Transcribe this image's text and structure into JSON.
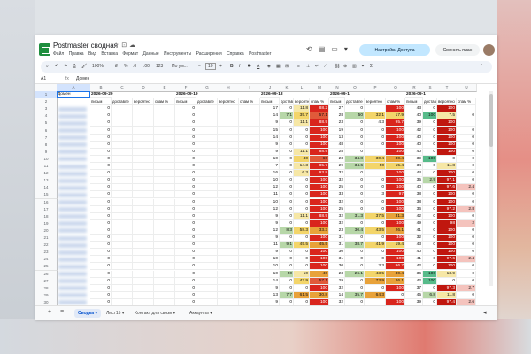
{
  "app": {
    "title": "Postmaster сводная",
    "menu": [
      "Файл",
      "Правка",
      "Вид",
      "Вставка",
      "Формат",
      "Данные",
      "Инструменты",
      "Расширения",
      "Справка",
      "Postmaster"
    ],
    "access_button": "Настройки Доступа",
    "plan_button": "Сменить план"
  },
  "toolbar": {
    "zoom": "100%",
    "currency": "₽",
    "percent": "%",
    "decimal_dec": ".0",
    "decimal_inc": ".00",
    "format_123": "123",
    "font": "По ум...",
    "font_size": "10",
    "bold": "B",
    "italic": "I",
    "strike": "S",
    "textcolor": "A"
  },
  "formula_bar": {
    "cell_ref": "A1",
    "fx": "fx",
    "content": "Домен"
  },
  "columns": [
    "A",
    "B",
    "C",
    "D",
    "E",
    "F",
    "G",
    "H",
    "I",
    "J",
    "K",
    "L",
    "M",
    "N",
    "O",
    "P",
    "Q",
    "R",
    "S",
    "T",
    "U"
  ],
  "header_row1": {
    "A": "Домен",
    "B": "2026-09-20",
    "F": "2026-09-19",
    "J": "2026-09-18",
    "N": "2026-09-1",
    "R": "2026-09-1"
  },
  "header_row2": [
    "письм",
    "доставле",
    "вероятно",
    "спам %",
    "письм",
    "доставле",
    "вероятно",
    "спам %",
    "письм",
    "доставле",
    "вероятно",
    "спам %",
    "письм",
    "доставле",
    "вероятно",
    "спам %",
    "письм",
    "доставле",
    "вероятно",
    "спам %"
  ],
  "rows": [
    {
      "r": 3,
      "c": [
        "0",
        "",
        "",
        "",
        "0",
        "",
        "",
        "",
        "17",
        "0",
        "11.8",
        "88.2",
        "27",
        "0",
        "",
        "100",
        "43",
        "0",
        "100",
        ""
      ]
    },
    {
      "r": 4,
      "c": [
        "0",
        "",
        "",
        "",
        "0",
        "",
        "",
        "",
        "14",
        "7.1",
        "35.7",
        "57.1",
        "28",
        "50",
        "32.1",
        "17.9",
        "40",
        "100",
        "7.5",
        "0"
      ]
    },
    {
      "r": 5,
      "c": [
        "0",
        "",
        "",
        "",
        "0",
        "",
        "",
        "",
        "9",
        "0",
        "11.1",
        "88.9",
        "23",
        "0",
        "4.3",
        "95.7",
        "39",
        "0",
        "100",
        ""
      ]
    },
    {
      "r": 6,
      "c": [
        "0",
        "",
        "",
        "",
        "0",
        "",
        "",
        "",
        "15",
        "0",
        "0",
        "100",
        "19",
        "0",
        "0",
        "100",
        "42",
        "0",
        "100",
        "0"
      ]
    },
    {
      "r": 7,
      "c": [
        "0",
        "",
        "",
        "",
        "0",
        "",
        "",
        "",
        "14",
        "0",
        "0",
        "100",
        "13",
        "0",
        "0",
        "100",
        "40",
        "0",
        "100",
        "0"
      ]
    },
    {
      "r": 8,
      "c": [
        "0",
        "",
        "",
        "",
        "0",
        "",
        "",
        "",
        "9",
        "0",
        "0",
        "100",
        "48",
        "0",
        "0",
        "100",
        "40",
        "0",
        "100",
        "0"
      ]
    },
    {
      "r": 9,
      "c": [
        "0",
        "",
        "",
        "",
        "0",
        "",
        "",
        "",
        "9",
        "0",
        "11.1",
        "88.9",
        "28",
        "0",
        "",
        "100",
        "40",
        "0",
        "100",
        "0"
      ]
    },
    {
      "r": 10,
      "c": [
        "0",
        "",
        "",
        "",
        "0",
        "",
        "",
        "",
        "10",
        "0",
        "40",
        "60",
        "23",
        "34.8",
        "30.4",
        "30.4",
        "39",
        "100",
        "0",
        "0"
      ]
    },
    {
      "r": 11,
      "c": [
        "0",
        "",
        "",
        "",
        "0",
        "",
        "",
        "",
        "7",
        "0",
        "14.3",
        "85.7",
        "29",
        "34.6",
        "50",
        "15.4",
        "34",
        "0",
        "11.8",
        "0"
      ]
    },
    {
      "r": 12,
      "c": [
        "0",
        "",
        "",
        "",
        "0",
        "",
        "",
        "",
        "16",
        "0",
        "6.3",
        "93.8",
        "32",
        "0",
        "",
        "100",
        "44",
        "0",
        "100",
        "0"
      ]
    },
    {
      "r": 13,
      "c": [
        "0",
        "",
        "",
        "",
        "0",
        "",
        "",
        "",
        "10",
        "0",
        "0",
        "100",
        "32",
        "0",
        "0",
        "100",
        "35",
        "2.9",
        "97.1",
        "0"
      ]
    },
    {
      "r": 14,
      "c": [
        "0",
        "",
        "",
        "",
        "0",
        "",
        "",
        "",
        "12",
        "0",
        "0",
        "100",
        "25",
        "0",
        "0",
        "100",
        "40",
        "0",
        "97.6",
        "2.4"
      ]
    },
    {
      "r": 15,
      "c": [
        "0",
        "",
        "",
        "",
        "0",
        "",
        "",
        "",
        "11",
        "0",
        "0",
        "100",
        "33",
        "0",
        "3",
        "97",
        "38",
        "0",
        "100",
        "0"
      ]
    },
    {
      "r": 16,
      "c": [
        "0",
        "",
        "",
        "",
        "0",
        "",
        "",
        "",
        "10",
        "0",
        "0",
        "100",
        "32",
        "0",
        "0",
        "100",
        "38",
        "0",
        "100",
        "0"
      ]
    },
    {
      "r": 17,
      "c": [
        "0",
        "",
        "",
        "",
        "0",
        "",
        "",
        "",
        "12",
        "0",
        "0",
        "100",
        "25",
        "0",
        "0",
        "100",
        "36",
        "0",
        "97.2",
        "2.8"
      ]
    },
    {
      "r": 18,
      "c": [
        "0",
        "",
        "",
        "",
        "0",
        "",
        "",
        "",
        "9",
        "0",
        "11.1",
        "88.9",
        "32",
        "31.3",
        "37.5",
        "31.3",
        "42",
        "0",
        "100",
        "0"
      ]
    },
    {
      "r": 19,
      "c": [
        "0",
        "",
        "",
        "",
        "0",
        "",
        "",
        "",
        "9",
        "0",
        "0",
        "100",
        "32",
        "0",
        "0",
        "100",
        "49",
        "0",
        "98",
        "2"
      ]
    },
    {
      "r": 20,
      "c": [
        "0",
        "",
        "",
        "",
        "0",
        "",
        "",
        "",
        "12",
        "8.3",
        "58.3",
        "33.3",
        "23",
        "30.4",
        "43.5",
        "26.1",
        "41",
        "0",
        "100",
        "0"
      ]
    },
    {
      "r": 21,
      "c": [
        "0",
        "",
        "",
        "",
        "0",
        "",
        "",
        "",
        "9",
        "0",
        "0",
        "100",
        "31",
        "0",
        "0",
        "100",
        "32",
        "0",
        "100",
        "0"
      ]
    },
    {
      "r": 22,
      "c": [
        "0",
        "",
        "",
        "",
        "0",
        "",
        "",
        "",
        "11",
        "9.1",
        "45.5",
        "45.5",
        "31",
        "38.7",
        "41.9",
        "19.4",
        "43",
        "0",
        "100",
        "0"
      ]
    },
    {
      "r": 23,
      "c": [
        "0",
        "",
        "",
        "",
        "0",
        "",
        "",
        "",
        "9",
        "0",
        "0",
        "100",
        "30",
        "0",
        "0",
        "100",
        "40",
        "0",
        "100",
        "0"
      ]
    },
    {
      "r": 24,
      "c": [
        "0",
        "",
        "",
        "",
        "0",
        "",
        "",
        "",
        "10",
        "0",
        "0",
        "100",
        "31",
        "0",
        "0",
        "100",
        "41",
        "0",
        "97.6",
        "2.4"
      ]
    },
    {
      "r": 25,
      "c": [
        "0",
        "",
        "",
        "",
        "0",
        "",
        "",
        "",
        "10",
        "0",
        "0",
        "100",
        "30",
        "0",
        "3.3",
        "96.7",
        "42",
        "0",
        "100",
        "0"
      ]
    },
    {
      "r": 26,
      "c": [
        "0",
        "",
        "",
        "",
        "0",
        "",
        "",
        "",
        "10",
        "50",
        "10",
        "40",
        "23",
        "26.1",
        "43.5",
        "30.4",
        "36",
        "100",
        "13.9",
        "0"
      ]
    },
    {
      "r": 27,
      "c": [
        "0",
        "",
        "",
        "",
        "0",
        "",
        "",
        "",
        "14",
        "0",
        "42.9",
        "57.1",
        "29",
        "0",
        "73.9",
        "26.1",
        "42",
        "100",
        "0",
        "0"
      ]
    },
    {
      "r": 28,
      "c": [
        "0",
        "",
        "",
        "",
        "0",
        "",
        "",
        "",
        "9",
        "0",
        "0",
        "100",
        "32",
        "0",
        "0",
        "100",
        "37",
        "0",
        "97.3",
        "2.7"
      ]
    },
    {
      "r": 29,
      "c": [
        "0",
        "",
        "",
        "",
        "0",
        "",
        "",
        "",
        "13",
        "7.7",
        "61.5",
        "30.8",
        "14",
        "35.7",
        "64.3",
        "0",
        "45",
        "6.8",
        "11.8",
        "0"
      ]
    },
    {
      "r": 30,
      "c": [
        "0",
        "",
        "",
        "",
        "0",
        "",
        "",
        "",
        "9",
        "0",
        "0",
        "100",
        "32",
        "0",
        "",
        "100",
        "39",
        "0",
        "97.4",
        "2.6"
      ]
    },
    {
      "r": 31,
      "c": [
        "0",
        "",
        "",
        "",
        "0",
        "",
        "",
        "",
        "12",
        "0",
        "0",
        "100",
        "30",
        "0",
        "0",
        "100",
        "35",
        "0",
        "97.1",
        "2.9"
      ]
    }
  ],
  "sheets": [
    "Сводка",
    "Лист15",
    "Контакт для связи",
    "Аккаунты"
  ],
  "colors": {
    "green": "#57bb8a",
    "light_green": "#b7d7a8",
    "yellow": "#f3d56a",
    "orange": "#e8a23a",
    "red": "#d9251d",
    "dark_red": "#c0170f",
    "blue_active": "#0b57d0"
  }
}
